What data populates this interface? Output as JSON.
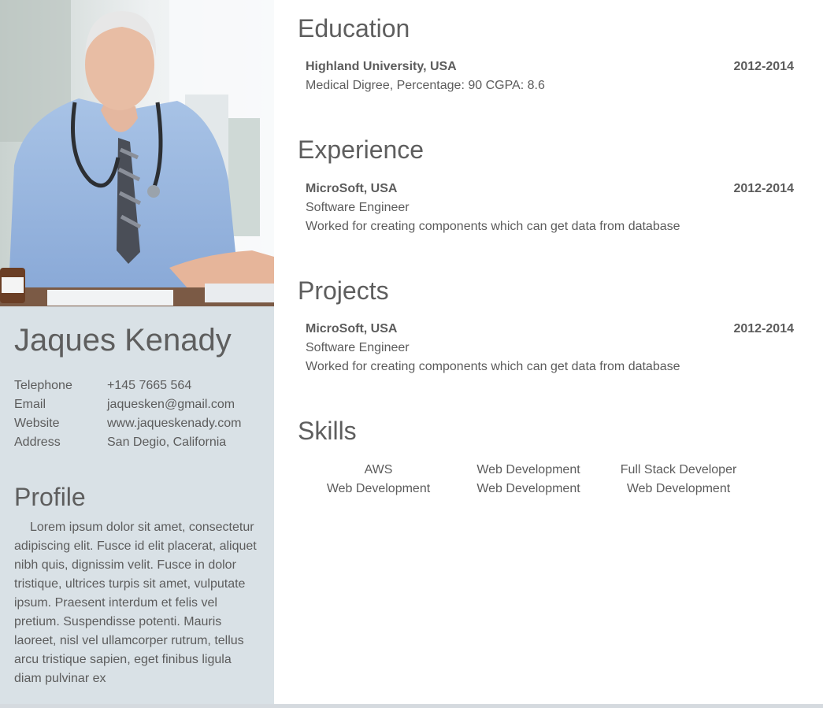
{
  "sidebar": {
    "name": "Jaques Kenady",
    "contact": [
      {
        "label": "Telephone",
        "value": "+145 7665 564"
      },
      {
        "label": "Email",
        "value": "jaquesken@gmail.com"
      },
      {
        "label": "Website",
        "value": "www.jaqueskenady.com"
      },
      {
        "label": "Address",
        "value": "San Degio, California"
      }
    ],
    "profile_title": "Profile",
    "profile_text": "Lorem ipsum dolor sit amet, consectetur adipiscing elit. Fusce id elit placerat, aliquet nibh quis, dignissim velit. Fusce in dolor tristique, ultrices turpis sit amet, vulputate ipsum. Praesent interdum et felis vel pretium. Suspendisse potenti. Mauris laoreet, nisl vel ullamcorper rutrum, tellus arcu tristique sapien, eget finibus ligula diam pulvinar ex"
  },
  "education": {
    "title": "Education",
    "institution": "Highland University, USA",
    "years": "2012-2014",
    "detail": "Medical Digree, Percentage: 90 CGPA: 8.6"
  },
  "experience": {
    "title": "Experience",
    "company": "MicroSoft, USA",
    "years": "2012-2014",
    "role": "Software Engineer",
    "description": "Worked for creating components which can get data from database"
  },
  "projects": {
    "title": "Projects",
    "company": "MicroSoft, USA",
    "years": "2012-2014",
    "role": "Software Engineer",
    "description": "Worked for creating components which can get data from database"
  },
  "skills": {
    "title": "Skills",
    "items": [
      "AWS",
      "Web Development",
      "Full Stack Developer",
      "Web Development",
      "Web Development",
      "Web Development"
    ]
  },
  "colors": {
    "sidebar_bg": "#d9e1e6",
    "text": "#5c5c5c",
    "heading": "#5e5e5e"
  }
}
